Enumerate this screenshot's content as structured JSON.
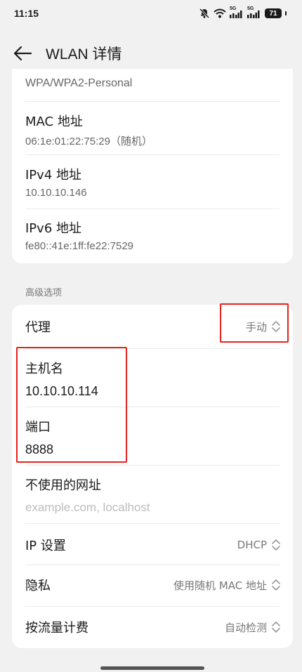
{
  "status_bar": {
    "time": "11:15",
    "signal1_label": "5G",
    "signal2_label": "5G",
    "battery": "71"
  },
  "header": {
    "title": "WLAN 详情"
  },
  "network_info": {
    "security_value": "WPA/WPA2-Personal",
    "mac": {
      "label": "MAC 地址",
      "value": "06:1e:01:22:75:29（随机）"
    },
    "ipv4": {
      "label": "IPv4 地址",
      "value": "10.10.10.146"
    },
    "ipv6": {
      "label": "IPv6 地址",
      "value": "fe80::41e:1ff:fe22:7529"
    }
  },
  "advanced": {
    "section_title": "高级选项",
    "proxy": {
      "label": "代理",
      "value": "手动"
    },
    "hostname": {
      "label": "主机名",
      "value": "10.10.10.114"
    },
    "port": {
      "label": "端口",
      "value": "8888"
    },
    "bypass": {
      "label": "不使用的网址",
      "placeholder": "example.com, localhost"
    },
    "ip_settings": {
      "label": "IP 设置",
      "value": "DHCP"
    },
    "privacy": {
      "label": "隐私",
      "value": "使用随机 MAC 地址"
    },
    "metered": {
      "label": "按流量计费",
      "value": "自动检测"
    }
  },
  "colors": {
    "highlight": "#e8221b",
    "background": "#f1f1f1",
    "card": "#ffffff"
  }
}
